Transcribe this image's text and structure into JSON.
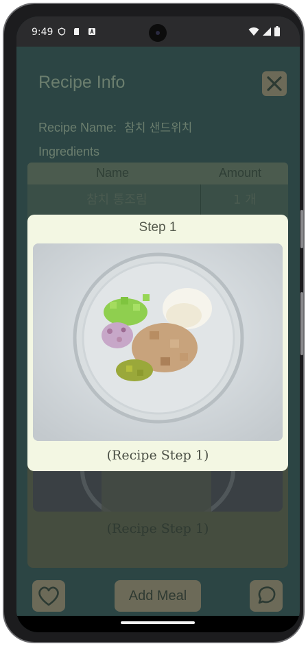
{
  "status_bar": {
    "time": "9:49"
  },
  "page": {
    "title": "Recipe Info",
    "recipe_name_label": "Recipe Name:",
    "recipe_name_value": "참치 샌드위치",
    "ingredients_label": "Ingredients"
  },
  "table": {
    "headers": [
      "Name",
      "Amount"
    ],
    "rows": [
      {
        "name": "참치 통조림",
        "amount": "1 개"
      }
    ]
  },
  "background_step": {
    "caption": "(Recipe Step 1)"
  },
  "footer": {
    "add_meal_label": "Add Meal"
  },
  "modal": {
    "title": "Step 1",
    "caption": "(Recipe Step 1)"
  },
  "colors": {
    "app_background_dimmed": "#2c4544",
    "modal_background": "#f3f7e3",
    "button_dimmed": "#6c6a58"
  },
  "icons": [
    "close-icon",
    "heart-icon",
    "chat-bubble-icon",
    "wifi-icon",
    "battery-icon",
    "shield-icon",
    "sd-card-icon",
    "font-icon"
  ]
}
